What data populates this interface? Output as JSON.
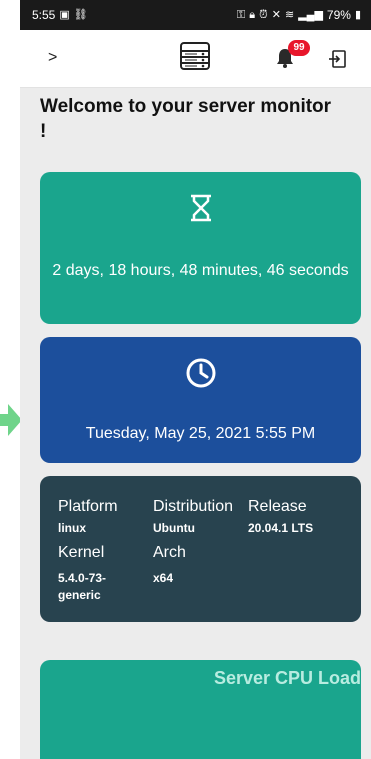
{
  "status_bar": {
    "time": "5:55",
    "battery": "79%"
  },
  "app_bar": {
    "notification_count": "99"
  },
  "welcome_text": "Welcome to your server monitor !",
  "uptime": {
    "text": "2 days, 18 hours, 48 minutes, 46 seconds"
  },
  "datetime": {
    "text": "Tuesday, May 25, 2021 5:55 PM"
  },
  "system_info": {
    "platform_label": "Platform",
    "platform_value": "linux",
    "distribution_label": "Distribution",
    "distribution_value": "Ubuntu",
    "release_label": "Release",
    "release_value": "20.04.1 LTS",
    "kernel_label": "Kernel",
    "kernel_value": "5.4.0-73-generic",
    "arch_label": "Arch",
    "arch_value": "x64"
  },
  "cpu_card": {
    "title": "Server CPU Load"
  },
  "colors": {
    "uptime_card": "#1aa58d",
    "date_card": "#1c4f9c",
    "system_card": "#28434f",
    "badge": "#e8162b",
    "arrow": "#6fd48a"
  }
}
